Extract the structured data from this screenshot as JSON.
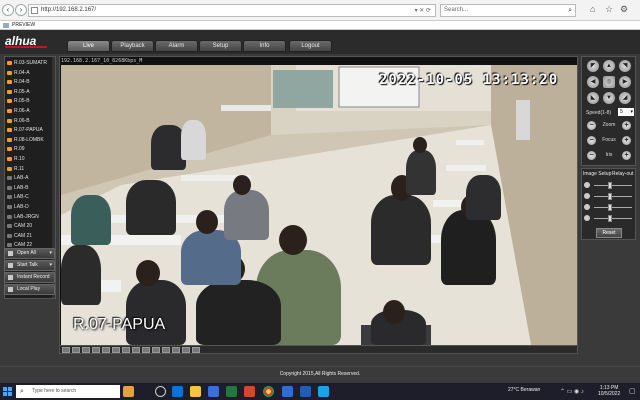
{
  "browser": {
    "url": "http://192.168.2.167/",
    "search_placeholder": "Search...",
    "tab_title": "PREVIEW"
  },
  "app": {
    "brand": "alhua",
    "nav_tabs": [
      "Live",
      "Playback",
      "Alarm",
      "Setup",
      "Info",
      "Logout"
    ],
    "active_tab": "Live"
  },
  "camera_list": [
    "R.03-SUMATR",
    "R.04-A",
    "R.04-B",
    "R.05-A",
    "R.05-B",
    "R.06-A",
    "R.06-B",
    "R.07-PAPUA",
    "R.08-LOMBK",
    "R.09",
    "R.10",
    "R.11",
    "LAB-A",
    "LAB-B",
    "LAB-C",
    "LAB-D",
    "LAB-JRGN",
    "CAM 20",
    "CAM 21",
    "CAM 22"
  ],
  "side_buttons": {
    "open_all": "Open All",
    "start_talk": "Start Talk",
    "instant_record": "Instant Record",
    "local_play": "Local Play"
  },
  "video": {
    "stream_label": "192.168.2.167_10_8268Kbps_M",
    "timestamp": "2022-10-05 13:13:20",
    "channel_name": "R.07-PAPUA"
  },
  "ptz": {
    "speed_label": "Speed(1-8)",
    "speed_value": "5",
    "zoom_label": "Zoom",
    "focus_label": "Focus",
    "iris_label": "Iris"
  },
  "image_panel": {
    "tab_image_setup": "Image Setup",
    "tab_relay_out": "Relay-out",
    "reset_label": "Reset"
  },
  "footer": {
    "copyright": "Copyright 2015,All Rights Reserved."
  },
  "taskbar": {
    "search_placeholder": "Type here to search",
    "weather": "27°C  Berawan",
    "time": "1:13 PM",
    "date": "10/5/2022"
  }
}
